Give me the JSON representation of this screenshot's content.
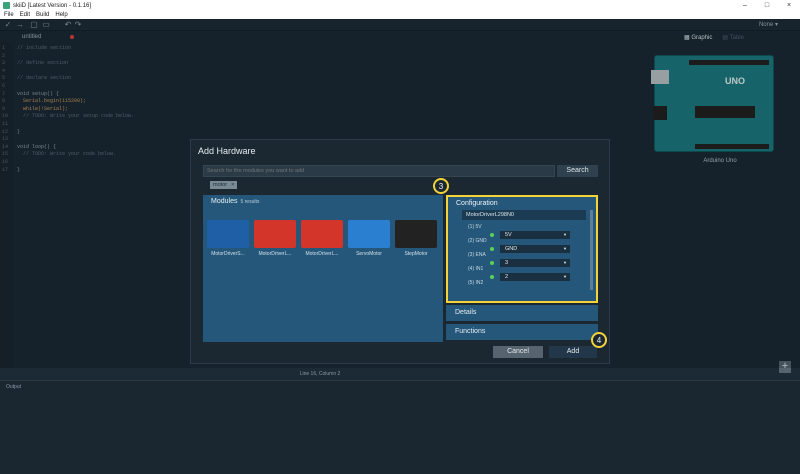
{
  "window": {
    "title": "skiiD [Latest Version - 0.1.16]",
    "controls": [
      "–",
      "□",
      "×"
    ]
  },
  "menu": [
    "File",
    "Edit",
    "Build",
    "Help"
  ],
  "toolbar": {
    "user": "None ▾"
  },
  "editor": {
    "tab_name": "untitled",
    "lines": [
      {
        "n": "1",
        "text": "// include section",
        "cls": "c-com"
      },
      {
        "n": "2",
        "text": "",
        "cls": ""
      },
      {
        "n": "3",
        "text": "// define section",
        "cls": "c-com"
      },
      {
        "n": "4",
        "text": "",
        "cls": ""
      },
      {
        "n": "5",
        "text": "// declare section",
        "cls": "c-com"
      },
      {
        "n": "6",
        "text": "",
        "cls": ""
      },
      {
        "n": "7",
        "text": "void setup() {",
        "cls": "c-kw"
      },
      {
        "n": "8",
        "text": "  Serial.begin(115200);",
        "cls": "c-fn"
      },
      {
        "n": "9",
        "text": "  while(!Serial);",
        "cls": "c-fn"
      },
      {
        "n": "10",
        "text": "  // TODO: Write your setup code below.",
        "cls": "c-com"
      },
      {
        "n": "11",
        "text": "",
        "cls": ""
      },
      {
        "n": "12",
        "text": "}",
        "cls": "c-kw"
      },
      {
        "n": "13",
        "text": "",
        "cls": ""
      },
      {
        "n": "14",
        "text": "void loop() {",
        "cls": "c-kw"
      },
      {
        "n": "15",
        "text": "  // TODO: Write your code below.",
        "cls": "c-com"
      },
      {
        "n": "16",
        "text": "",
        "cls": ""
      },
      {
        "n": "17",
        "text": "}",
        "cls": "c-kw"
      }
    ]
  },
  "right_panel": {
    "tab_graphic": "Graphic",
    "tab_table": "Table",
    "board_label": "Arduino Uno",
    "board_logo": "UNO",
    "add_icon": "+"
  },
  "statusbar": "Line 16, Column 2",
  "output": {
    "label": "Output"
  },
  "dialog": {
    "title": "Add Hardware",
    "search_placeholder": "Search for the modules you want to add",
    "search_button": "Search",
    "tag": "motor",
    "tag_close": "×",
    "modules_title": "Modules",
    "modules_count": "5 results",
    "modules": [
      {
        "name": "MotorDriverS...",
        "color": "#1f5fa6"
      },
      {
        "name": "MotorDriverL...",
        "color": "#d3352b"
      },
      {
        "name": "MotorDriverL...",
        "color": "#d3352b"
      },
      {
        "name": "ServoMotor",
        "color": "#2b7fd0"
      },
      {
        "name": "StepMotor",
        "color": "#222222"
      }
    ],
    "config": {
      "title": "Configuration",
      "module_name": "MotorDriverL298N0",
      "pins": [
        {
          "label": "(1) 5V",
          "value": "5V"
        },
        {
          "label": "(2) GND",
          "value": "GND"
        },
        {
          "label": "(3) ENA",
          "value": "3"
        },
        {
          "label": "(4) IN1",
          "value": "2"
        },
        {
          "label": "(5) IN2",
          "value": ""
        }
      ]
    },
    "details": "Details",
    "functions": "Functions",
    "cancel": "Cancel",
    "add": "Add",
    "badge3": "3",
    "badge4": "4"
  },
  "colors": {
    "accent": "#f3d33a",
    "panel": "#24577a",
    "background": "#1c2a35",
    "pin_ok": "#5ad05a"
  }
}
